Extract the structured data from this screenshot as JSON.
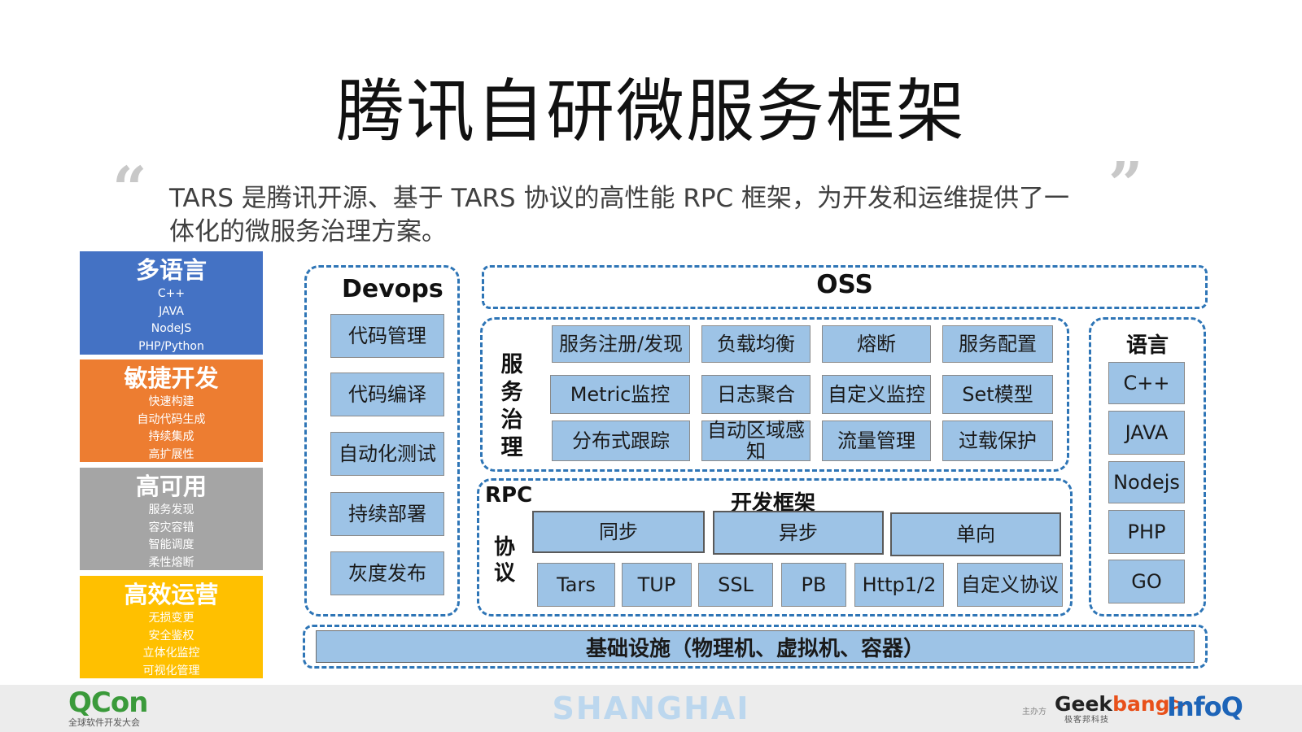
{
  "title": "腾讯自研微服务框架",
  "quote": {
    "open": "“",
    "close": "”"
  },
  "subtitle": "TARS 是腾讯开源、基于 TARS 协议的高性能 RPC 框架，为开发和运维提供了一体化的微服务治理方案。",
  "features": [
    {
      "heading": "多语言",
      "items": [
        "C++",
        "JAVA",
        "NodeJS",
        "PHP/Python"
      ],
      "color": "#4472c4"
    },
    {
      "heading": "敏捷开发",
      "items": [
        "快速构建",
        "自动代码生成",
        "持续集成",
        "高扩展性"
      ],
      "color": "#ed7d31"
    },
    {
      "heading": "高可用",
      "items": [
        "服务发现",
        "容灾容错",
        "智能调度",
        "柔性熔断"
      ],
      "color": "#a5a5a5"
    },
    {
      "heading": "高效运营",
      "items": [
        "无损变更",
        "安全鉴权",
        "立体化监控",
        "可视化管理"
      ],
      "color": "#ffc000"
    }
  ],
  "devops": {
    "title": "Devops",
    "items": [
      "代码管理",
      "代码编译",
      "自动化测试",
      "持续部署",
      "灰度发布"
    ]
  },
  "oss": {
    "title": "OSS"
  },
  "service_governance": {
    "title": "服务治理",
    "rows": [
      [
        "服务注册/发现",
        "负载均衡",
        "熔断",
        "服务配置"
      ],
      [
        "Metric监控",
        "日志聚合",
        "自定义监控",
        "Set模型"
      ],
      [
        "分布式跟踪",
        "自动区域感知",
        "流量管理",
        "过载保护"
      ]
    ]
  },
  "rpc": {
    "title": "RPC",
    "protocol_label": "协议",
    "framework_title": "开发框架",
    "framework_items": [
      "同步",
      "异步",
      "单向"
    ],
    "protocols": [
      "Tars",
      "TUP",
      "SSL",
      "PB",
      "Http1/2",
      "自定义协议"
    ]
  },
  "languages": {
    "title": "语言",
    "items": [
      "C++",
      "JAVA",
      "Nodejs",
      "PHP",
      "GO"
    ]
  },
  "infrastructure": "基础设施（物理机、虚拟机、容器）",
  "footer": {
    "qcon": "QCon",
    "qcon_sub": "全球软件开发大会",
    "city": "SHANGHAI",
    "organizer_label": "主办方",
    "geek_prefix": "Geek",
    "geek_suffix": "bang>",
    "geek_sub": "极客邦科技",
    "infoq": "InfoQ"
  },
  "colors": {
    "cell_fill": "#9dc3e6",
    "dashed_border": "#2e75b6"
  }
}
